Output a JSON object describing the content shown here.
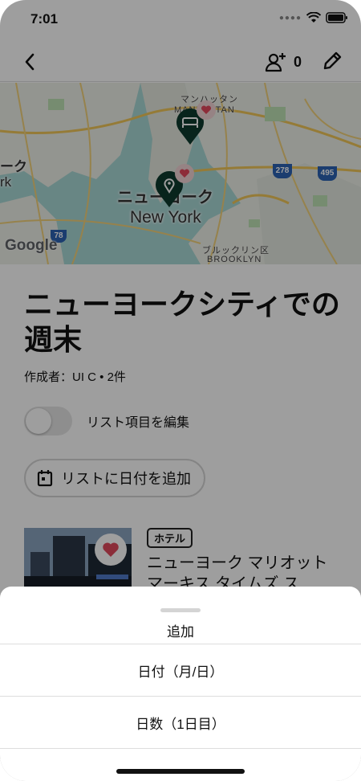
{
  "status_bar": {
    "time": "7:01"
  },
  "nav": {
    "share_count": "0"
  },
  "map": {
    "label_manhattan_jp": "マンハッタン",
    "label_manhattan_en": "MANHATTAN",
    "label_newyork_jp": "ニューヨーク",
    "label_newyork_en": "New York",
    "label_brooklyn_jp": "ブルックリン区",
    "label_brooklyn_en": "BROOKLYN",
    "label_left_jp": "ーク",
    "label_left_en": "rk",
    "route_278": "278",
    "route_495": "495",
    "route_78": "78",
    "google": "Google"
  },
  "list": {
    "title": "ニューヨークシティでの週末",
    "meta": "作成者：UI C • 2件",
    "toggle_label": "リスト項目を編集",
    "add_date_label": "リストに日付を追加"
  },
  "item": {
    "badge": "ホテル",
    "title": "ニューヨーク マリオット マーキス タイムズ ス"
  },
  "sheet": {
    "title": "追加",
    "options": [
      "日付（月/日）",
      "日数（1日目）"
    ]
  }
}
